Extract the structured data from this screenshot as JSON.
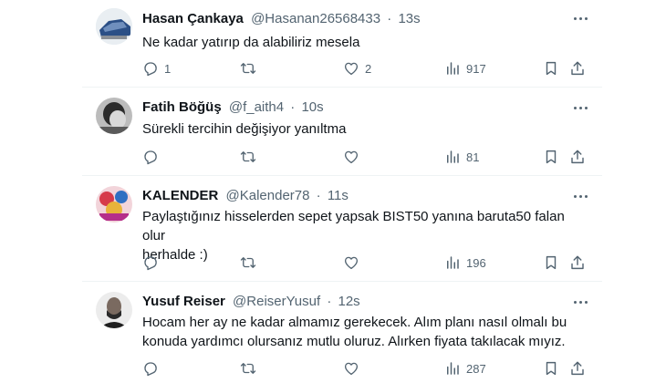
{
  "tweets": [
    {
      "display_name": "Hasan Çankaya",
      "handle": "@Hasanan26568433",
      "separator": "·",
      "time": "13s",
      "text": "Ne kadar yatırıp da alabiliriz mesela",
      "reply_count": "1",
      "retweet_count": "",
      "like_count": "2",
      "view_count": "917"
    },
    {
      "display_name": "Fatih Böğüş",
      "handle": "@f_aith4",
      "separator": "·",
      "time": "10s",
      "text": "Sürekli tercihin değişiyor yanıltma",
      "reply_count": "",
      "retweet_count": "",
      "like_count": "",
      "view_count": "81"
    },
    {
      "display_name": "KALENDER",
      "handle": "@Kalender78",
      "separator": "·",
      "time": "11s",
      "text_line1": "Paylaştığınız hisselerden sepet yapsak BIST50 yanına baruta50 falan olur",
      "text_line2": "herhalde :)",
      "reply_count": "",
      "retweet_count": "",
      "like_count": "",
      "view_count": "196"
    },
    {
      "display_name": "Yusuf Reiser",
      "handle": "@ReiserYusuf",
      "separator": "·",
      "time": "12s",
      "text_line1": "Hocam her ay ne kadar almamız gerekecek. Alım planı nasıl olmalı bu",
      "text_line2": "konuda yardımcı olursanız mutlu oluruz. Alırken fiyata takılacak mıyız.",
      "reply_count": "",
      "retweet_count": "",
      "like_count": "",
      "view_count": "287"
    }
  ],
  "icons": {
    "reply": "reply-icon",
    "retweet": "retweet-icon",
    "like": "like-icon",
    "views": "views-icon",
    "bookmark": "bookmark-icon",
    "share": "share-icon",
    "more": "more-icon"
  },
  "colors": {
    "text": "#0f1419",
    "muted": "#536471",
    "divider": "#eff3f4"
  }
}
